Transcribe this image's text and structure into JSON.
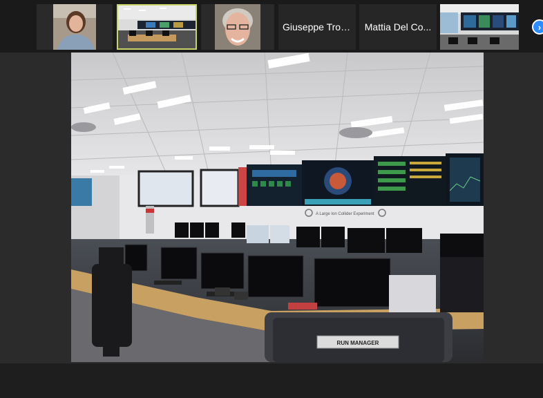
{
  "participants": [
    {
      "type": "video",
      "name": "participant-woman"
    },
    {
      "type": "video",
      "name": "control-room-feed",
      "active": true
    },
    {
      "type": "video",
      "name": "participant-smiling"
    },
    {
      "type": "name",
      "label": "Giuseppe Troian"
    },
    {
      "type": "name",
      "label": "Mattia Del Co..."
    },
    {
      "type": "video",
      "name": "control-room-screens"
    }
  ],
  "main_video": {
    "screen_sign": "A Large Ion Collider Experiment",
    "desk_sign": "RUN MANAGER"
  },
  "icons": {
    "next": "chevron-right-icon"
  },
  "colors": {
    "active_border": "#c8d36a",
    "accent": "#2d8cff"
  }
}
